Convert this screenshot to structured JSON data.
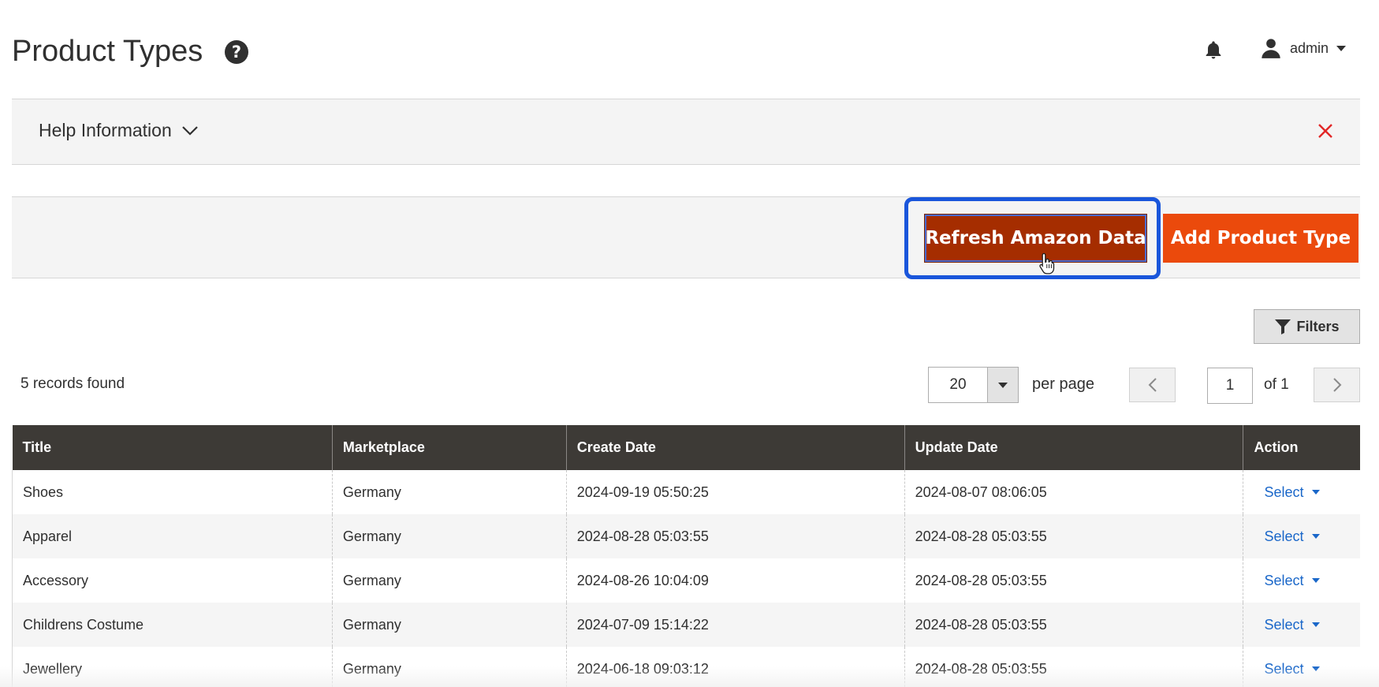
{
  "header": {
    "title": "Product Types",
    "user": "admin"
  },
  "help": {
    "label": "Help Information"
  },
  "actions": {
    "refresh_label": "Refresh Amazon Data",
    "add_label": "Add Product Type"
  },
  "filters": {
    "label": "Filters"
  },
  "pager": {
    "records_text": "5 records found",
    "per_page_value": "20",
    "per_page_label": "per page",
    "current_page": "1",
    "of_text": "of 1"
  },
  "table": {
    "columns": [
      "Title",
      "Marketplace",
      "Create Date",
      "Update Date",
      "Action"
    ],
    "rows": [
      {
        "title": "Shoes",
        "marketplace": "Germany",
        "create": "2024-09-19 05:50:25",
        "update": "2024-08-07 08:06:05",
        "action": "Select"
      },
      {
        "title": "Apparel",
        "marketplace": "Germany",
        "create": "2024-08-28 05:03:55",
        "update": "2024-08-28 05:03:55",
        "action": "Select"
      },
      {
        "title": "Accessory",
        "marketplace": "Germany",
        "create": "2024-08-26 10:04:09",
        "update": "2024-08-28 05:03:55",
        "action": "Select"
      },
      {
        "title": "Childrens Costume",
        "marketplace": "Germany",
        "create": "2024-07-09 15:14:22",
        "update": "2024-08-28 05:03:55",
        "action": "Select"
      },
      {
        "title": "Jewellery",
        "marketplace": "Germany",
        "create": "2024-06-18 09:03:12",
        "update": "2024-08-28 05:03:55",
        "action": "Select"
      }
    ]
  },
  "colors": {
    "primary_button": "#eb4a0c",
    "primary_button_active": "#a52d00",
    "focus_ring": "#1a56db",
    "table_header": "#3d3a36",
    "link": "#1a67c9",
    "close_icon": "#e22626"
  },
  "icons": {
    "help": "question-circle-icon",
    "notifications": "bell-icon",
    "user": "user-icon",
    "help_toggle": "chevron-down-icon",
    "help_close": "close-icon",
    "filters": "funnel-icon",
    "prev": "chevron-left-icon",
    "next": "chevron-right-icon"
  }
}
